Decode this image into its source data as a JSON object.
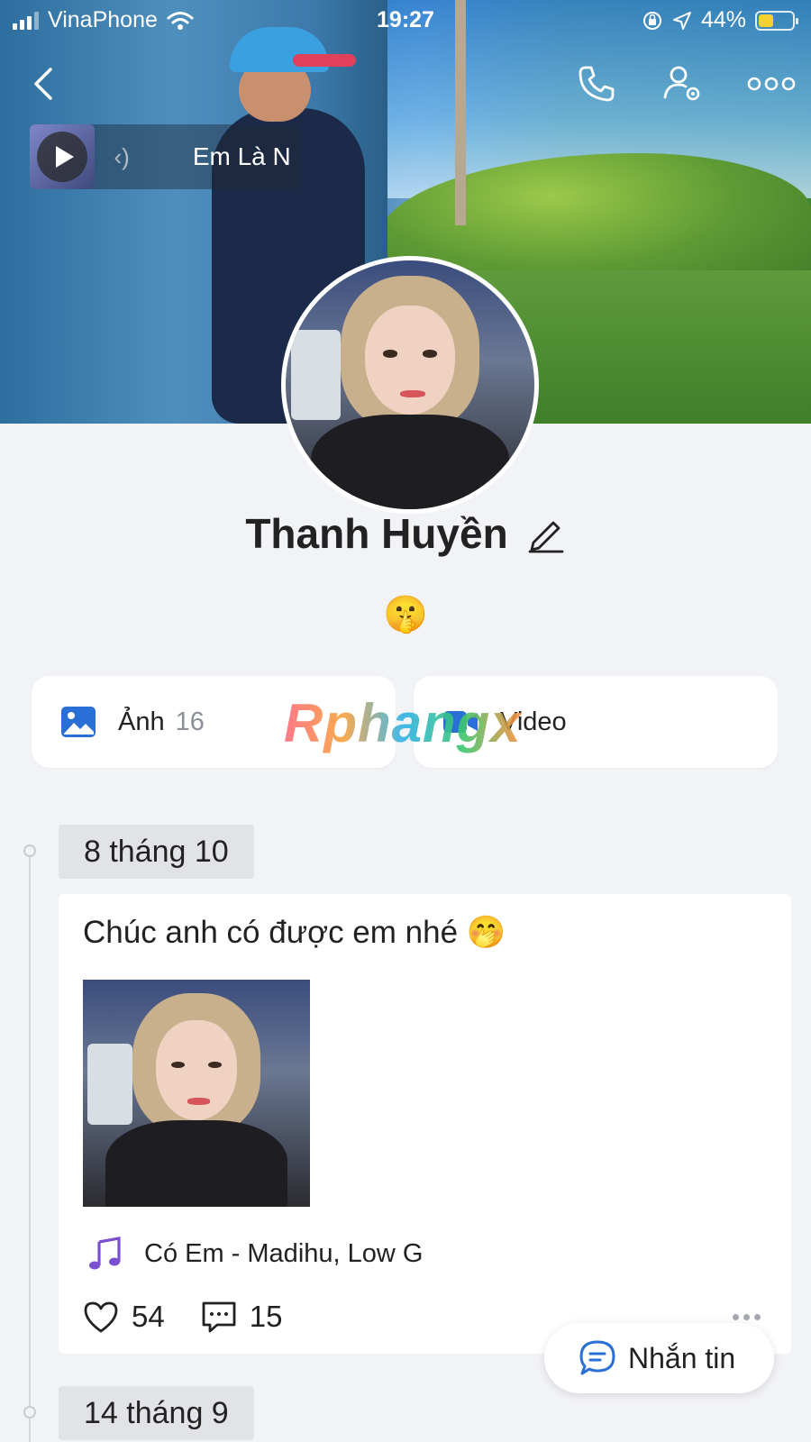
{
  "status_bar": {
    "carrier": "VinaPhone",
    "time": "19:27",
    "battery": "44%"
  },
  "music": {
    "title": "Em Là N",
    "eq_glyph": "‹)"
  },
  "profile": {
    "name": "Thanh Huyền",
    "bio_emoji": "🤫"
  },
  "cards": {
    "photos_label": "Ảnh",
    "photos_count": "16",
    "video_label": "Video"
  },
  "watermark": "Rphangx",
  "timeline": [
    {
      "date": "8 tháng 10",
      "text": "Chúc anh có được em nhé 🤭",
      "song": "Có Em - Madihu, Low G",
      "likes": "54",
      "comments": "15"
    },
    {
      "date": "14 tháng 9"
    }
  ],
  "fab": {
    "label": "Nhắn tin"
  },
  "colors": {
    "accent": "#2a6fd6",
    "music_icon": "#7a4fd0",
    "background": "#f2f3f6"
  },
  "icons": [
    "back-icon",
    "phone-icon",
    "user-settings-icon",
    "more-icon",
    "pencil-icon",
    "image-icon",
    "video-icon",
    "music-note-icon",
    "heart-icon",
    "comment-icon",
    "chat-icon"
  ]
}
